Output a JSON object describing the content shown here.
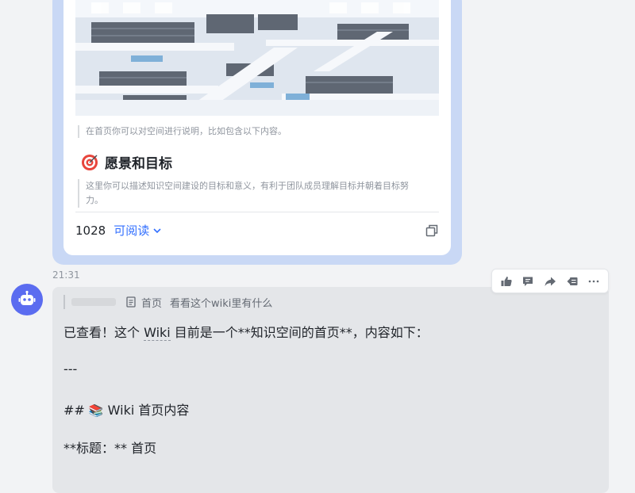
{
  "card": {
    "intro_text": "在首页你可以对空间进行说明，比如包含以下内容。",
    "section_title": "愿景和目标",
    "section_desc_line1": "这里你可以描述知识空间建设的目标和意义，有利于团队成员理解目标并朝着目标努",
    "section_desc_line2": "力。",
    "read_count": "1028",
    "read_label": "可阅读"
  },
  "timestamp": "21:31",
  "reply_ref": {
    "doc_title": "首页",
    "quoted_text": "看看这个wiki里有什么"
  },
  "message": {
    "line1_prefix": "已查看！这个 ",
    "line1_link": "Wiki",
    "line1_suffix": " 目前是一个**知识空间的首页**，内容如下：",
    "line2": "---",
    "line3_prefix": "## ",
    "line3_emoji": "📚",
    "line3_text": " Wiki 首页内容",
    "line4": "**标题：** 首页"
  },
  "colors": {
    "accent": "#3370ff",
    "avatar_bg": "#5b6cf0",
    "card_border": "#c9d8f5",
    "bubble_bg": "#e4e6e9"
  },
  "icons": {
    "target": "target-icon",
    "copy": "copy-icon",
    "doc": "doc-icon",
    "avatar": "robot-icon",
    "toolbar": [
      "thumbs-up-icon",
      "comment-icon",
      "forward-icon",
      "quote-icon",
      "more-icon"
    ]
  }
}
